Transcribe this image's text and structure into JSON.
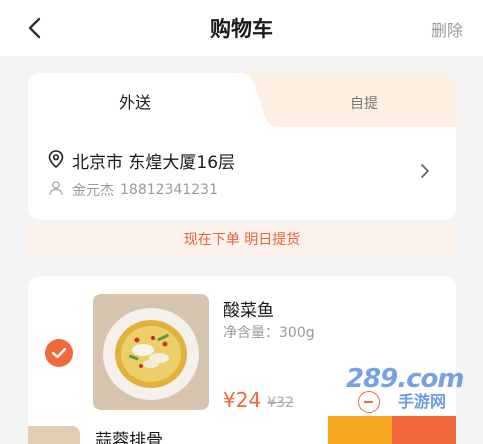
{
  "nav": {
    "title": "购物车",
    "delete_label": "删除"
  },
  "tabs": {
    "delivery": "外送",
    "pickup": "自提"
  },
  "address": {
    "line": "北京市 东煌大厦16层",
    "contact_name": "金元杰",
    "contact_phone": "18812341231"
  },
  "notice": "现在下单 明日提货",
  "cart_items": [
    {
      "name": "酸菜鱼",
      "weight": "净含量：300g",
      "price": "¥24",
      "original_price": "¥32",
      "checked": true
    },
    {
      "name": "蒜蓉排骨"
    }
  ],
  "watermark": {
    "text": "289.com",
    "sub": "手游网"
  },
  "colors": {
    "accent": "#f1693a",
    "notice_bg": "#fdf1ec",
    "pickup_tab_bg": "#fdf0e3",
    "background": "#f4f4f4"
  },
  "icons": [
    "back-arrow-icon",
    "location-pin-icon",
    "person-icon",
    "chevron-right-icon",
    "checkmark-icon",
    "minus-icon"
  ]
}
